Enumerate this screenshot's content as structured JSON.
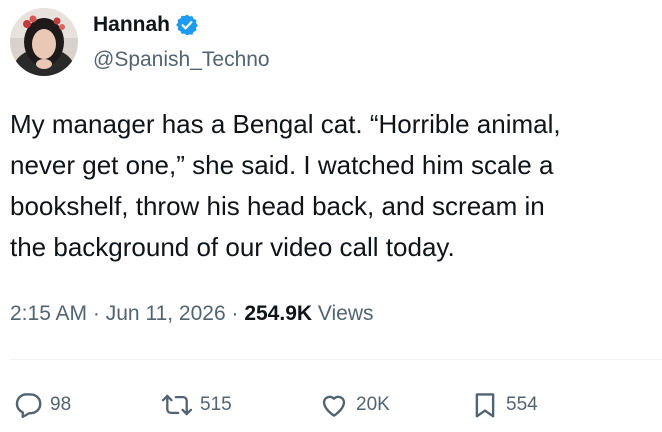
{
  "author": {
    "display_name": "Hannah",
    "handle": "@Spanish_Techno",
    "verified": true,
    "avatar": "avatar-photo"
  },
  "tweet": {
    "text": "My manager has a Bengal cat. “Horrible animal,\nnever get one,” she said. I watched him scale a\nbookshelf, throw his head back, and scream in\nthe background of our video call today.",
    "time": "2:15 AM",
    "separator": "·",
    "date": "Jun 11, 2026",
    "views_count": "254.9K",
    "views_label": "Views"
  },
  "actions": {
    "reply": {
      "icon": "reply-icon",
      "count": "98"
    },
    "retweet": {
      "icon": "retweet-icon",
      "count": "515"
    },
    "like": {
      "icon": "heart-icon",
      "count": "20K"
    },
    "bookmark": {
      "icon": "bookmark-icon",
      "count": "554"
    }
  },
  "colors": {
    "text_primary": "#0f1419",
    "text_secondary": "#536471",
    "verified_blue": "#1d9bf0",
    "divider": "#eff3f4"
  }
}
